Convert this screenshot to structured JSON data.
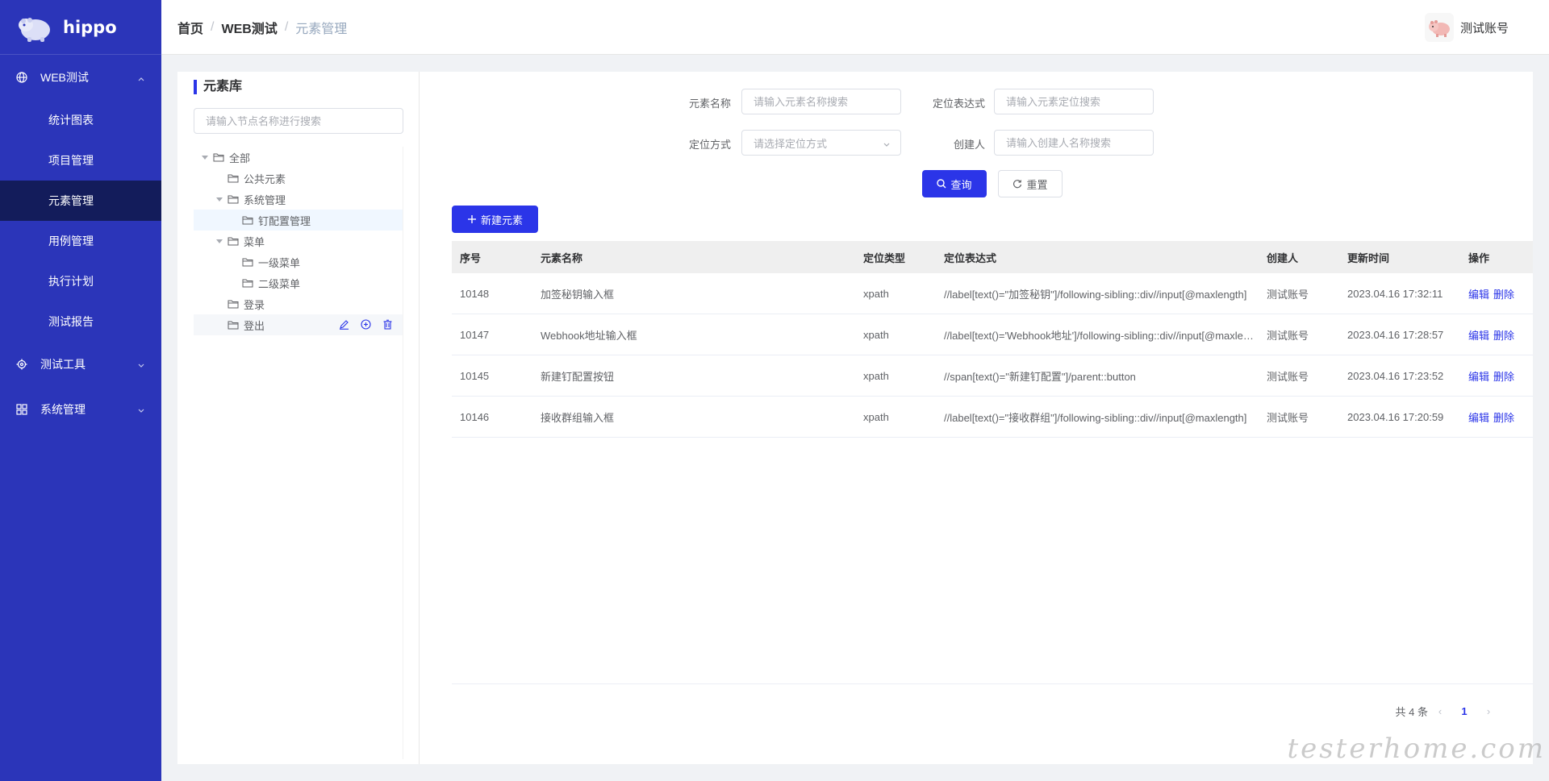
{
  "app": {
    "name": "hippo"
  },
  "sidebar": {
    "groups": [
      {
        "label": "WEB测试",
        "items": [
          "统计图表",
          "项目管理",
          "元素管理",
          "用例管理",
          "执行计划",
          "测试报告"
        ],
        "active": "元素管理"
      },
      {
        "label": "测试工具"
      },
      {
        "label": "系统管理"
      }
    ]
  },
  "header": {
    "breadcrumb": [
      "首页",
      "WEB测试",
      "元素管理"
    ],
    "separator": "/",
    "user": "测试账号"
  },
  "tree": {
    "title": "元素库",
    "search_placeholder": "请输入节点名称进行搜索",
    "nodes": [
      "全部",
      "公共元素",
      "系统管理",
      "钉配置管理",
      "菜单",
      "一级菜单",
      "二级菜单",
      "登录",
      "登出"
    ]
  },
  "filters": {
    "name_label": "元素名称",
    "name_placeholder": "请输入元素名称搜索",
    "expr_label": "定位表达式",
    "expr_placeholder": "请输入元素定位搜索",
    "method_label": "定位方式",
    "method_placeholder": "请选择定位方式",
    "creator_label": "创建人",
    "creator_placeholder": "请输入创建人名称搜索",
    "query_btn": "查询",
    "reset_btn": "重置"
  },
  "new_btn": "新建元素",
  "table": {
    "headers": [
      "序号",
      "元素名称",
      "定位类型",
      "定位表达式",
      "创建人",
      "更新时间",
      "操作"
    ],
    "rows": [
      [
        "10148",
        "加签秘钥输入框",
        "xpath",
        "//label[text()=\"加签秘钥\"]/following-sibling::div//input[@maxlength]",
        "测试账号",
        "2023.04.16 17:32:11"
      ],
      [
        "10147",
        "Webhook地址输入框",
        "xpath",
        "//label[text()='Webhook地址']/following-sibling::div//input[@maxlength]",
        "测试账号",
        "2023.04.16 17:28:57"
      ],
      [
        "10145",
        "新建钉配置按钮",
        "xpath",
        "//span[text()=\"新建钉配置\"]/parent::button",
        "测试账号",
        "2023.04.16 17:23:52"
      ],
      [
        "10146",
        "接收群组输入框",
        "xpath",
        "//label[text()=\"接收群组\"]/following-sibling::div//input[@maxlength]",
        "测试账号",
        "2023.04.16 17:20:59"
      ]
    ],
    "edit": "编辑",
    "delete": "删除"
  },
  "pager": {
    "total": "共 4 条",
    "page": "1"
  },
  "watermark": "testerhome.com"
}
